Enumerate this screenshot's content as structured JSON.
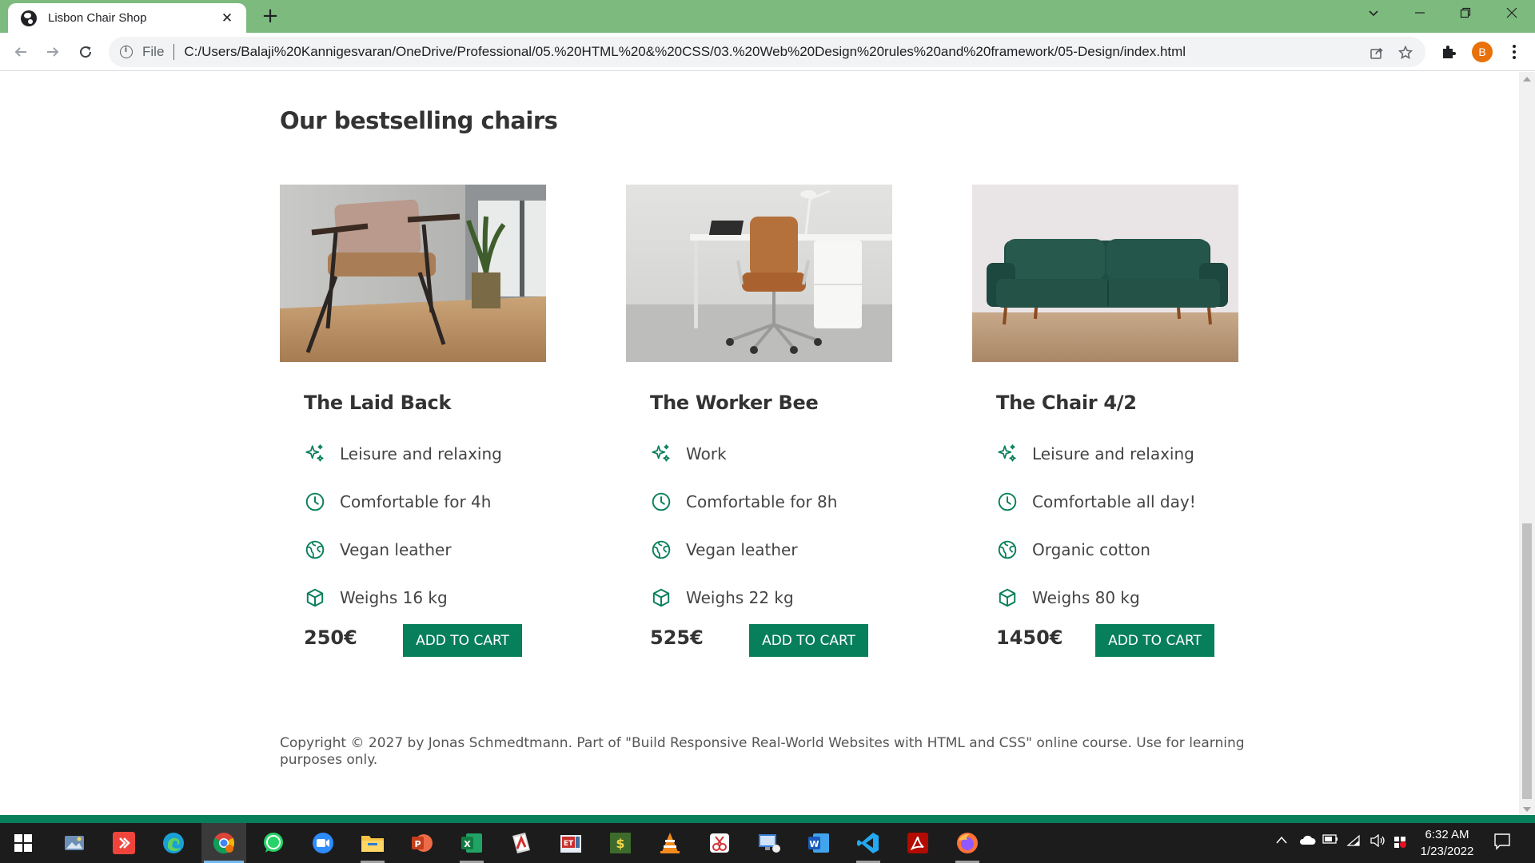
{
  "browser": {
    "tab_title": "Lisbon Chair Shop",
    "file_label": "File",
    "url": "C:/Users/Balaji%20Kannigesvaran/OneDrive/Professional/05.%20HTML%20&%20CSS/03.%20Web%20Design%20rules%20and%20framework/05-Design/index.html",
    "profile_initial": "B"
  },
  "page": {
    "heading": "Our bestselling chairs",
    "products": [
      {
        "name": "The Laid Back",
        "attributes": [
          "Leisure and relaxing",
          "Comfortable for 4h",
          "Vegan leather",
          "Weighs 16 kg"
        ],
        "price": "250€",
        "button": "ADD TO CART"
      },
      {
        "name": "The Worker Bee",
        "attributes": [
          "Work",
          "Comfortable for 8h",
          "Vegan leather",
          "Weighs 22 kg"
        ],
        "price": "525€",
        "button": "ADD TO CART"
      },
      {
        "name": "The Chair 4/2",
        "attributes": [
          "Leisure and relaxing",
          "Comfortable all day!",
          "Organic cotton",
          "Weighs 80 kg"
        ],
        "price": "1450€",
        "button": "ADD TO CART"
      }
    ],
    "footer": "Copyright © 2027 by Jonas Schmedtmann. Part of \"Build Responsive Real-World Websites with HTML and CSS\" online course. Use for learning purposes only."
  },
  "taskbar": {
    "time": "6:32 AM",
    "date": "1/23/2022"
  },
  "colors": {
    "brand_green": "#087f5b",
    "chrome_frame": "#7dba7e"
  }
}
